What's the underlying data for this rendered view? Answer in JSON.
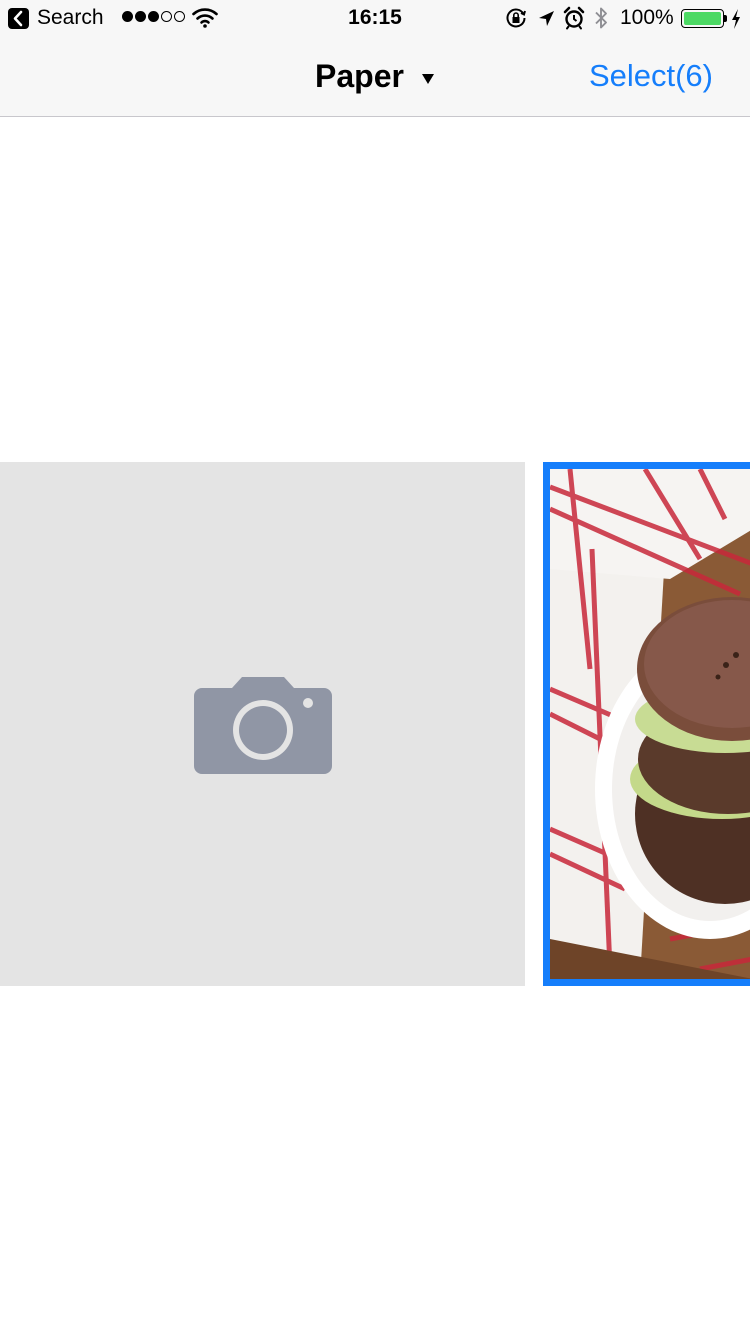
{
  "status_bar": {
    "back_app": "Search",
    "time": "16:15",
    "battery_percent": "100%",
    "battery_level": 1.0,
    "signal_bars_filled": 3,
    "signal_bars_total": 5,
    "icons": [
      "back-arrow-icon",
      "wifi-icon",
      "orientation-lock-icon",
      "location-arrow-icon",
      "alarm-icon",
      "bluetooth-icon",
      "battery-icon",
      "charging-bolt-icon"
    ]
  },
  "nav": {
    "title": "Paper",
    "title_icon": "caret-down-icon",
    "select_label": "Select(6)"
  },
  "grid": {
    "tiles": [
      {
        "kind": "placeholder",
        "icon": "camera-icon"
      },
      {
        "kind": "photo",
        "subject": "sandwich-cookie-photo",
        "selected": true
      }
    ]
  },
  "colors": {
    "accent": "#157efb",
    "bar_background": "#f7f7f7",
    "placeholder_background": "#e4e4e4",
    "placeholder_icon": "#9096a5",
    "battery_fill": "#4cd964"
  }
}
